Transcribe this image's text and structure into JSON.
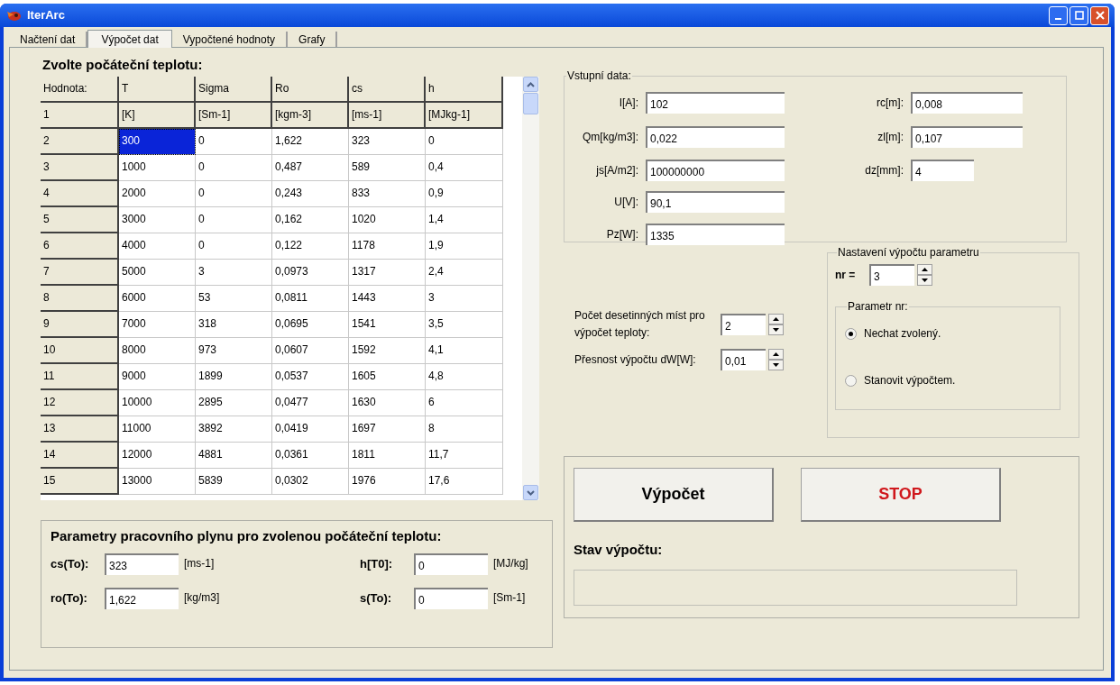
{
  "window": {
    "title": "IterArc"
  },
  "tabs": [
    {
      "label": "Načtení dat",
      "selected": false
    },
    {
      "label": "Výpočet dat",
      "selected": true
    },
    {
      "label": "Vypočtené hodnoty",
      "selected": false
    },
    {
      "label": "Grafy",
      "selected": false
    }
  ],
  "grid": {
    "title": "Zvolte počáteční teplotu:",
    "columns": [
      "Hodnota:",
      "T",
      "Sigma",
      "Ro",
      "cs",
      "h"
    ],
    "units": [
      "1",
      "[K]",
      "[Sm-1]",
      "[kgm-3]",
      "[ms-1]",
      "[MJkg-1]"
    ],
    "rows": [
      {
        "cells": [
          {
            "text": "2",
            "selected": false
          },
          {
            "text": "300",
            "selected": true
          },
          {
            "text": "0",
            "selected": false
          },
          {
            "text": "1,622",
            "selected": false
          },
          {
            "text": "323",
            "selected": false
          },
          {
            "text": "0",
            "selected": false
          }
        ]
      },
      {
        "cells": [
          {
            "text": "3",
            "selected": false
          },
          {
            "text": "1000",
            "selected": false
          },
          {
            "text": "0",
            "selected": false
          },
          {
            "text": "0,487",
            "selected": false
          },
          {
            "text": "589",
            "selected": false
          },
          {
            "text": "0,4",
            "selected": false
          }
        ]
      },
      {
        "cells": [
          {
            "text": "4",
            "selected": false
          },
          {
            "text": "2000",
            "selected": false
          },
          {
            "text": "0",
            "selected": false
          },
          {
            "text": "0,243",
            "selected": false
          },
          {
            "text": "833",
            "selected": false
          },
          {
            "text": "0,9",
            "selected": false
          }
        ]
      },
      {
        "cells": [
          {
            "text": "5",
            "selected": false
          },
          {
            "text": "3000",
            "selected": false
          },
          {
            "text": "0",
            "selected": false
          },
          {
            "text": "0,162",
            "selected": false
          },
          {
            "text": "1020",
            "selected": false
          },
          {
            "text": "1,4",
            "selected": false
          }
        ]
      },
      {
        "cells": [
          {
            "text": "6",
            "selected": false
          },
          {
            "text": "4000",
            "selected": false
          },
          {
            "text": "0",
            "selected": false
          },
          {
            "text": "0,122",
            "selected": false
          },
          {
            "text": "1178",
            "selected": false
          },
          {
            "text": "1,9",
            "selected": false
          }
        ]
      },
      {
        "cells": [
          {
            "text": "7",
            "selected": false
          },
          {
            "text": "5000",
            "selected": false
          },
          {
            "text": "3",
            "selected": false
          },
          {
            "text": "0,0973",
            "selected": false
          },
          {
            "text": "1317",
            "selected": false
          },
          {
            "text": "2,4",
            "selected": false
          }
        ]
      },
      {
        "cells": [
          {
            "text": "8",
            "selected": false
          },
          {
            "text": "6000",
            "selected": false
          },
          {
            "text": "53",
            "selected": false
          },
          {
            "text": "0,0811",
            "selected": false
          },
          {
            "text": "1443",
            "selected": false
          },
          {
            "text": "3",
            "selected": false
          }
        ]
      },
      {
        "cells": [
          {
            "text": "9",
            "selected": false
          },
          {
            "text": "7000",
            "selected": false
          },
          {
            "text": "318",
            "selected": false
          },
          {
            "text": "0,0695",
            "selected": false
          },
          {
            "text": "1541",
            "selected": false
          },
          {
            "text": "3,5",
            "selected": false
          }
        ]
      },
      {
        "cells": [
          {
            "text": "10",
            "selected": false
          },
          {
            "text": "8000",
            "selected": false
          },
          {
            "text": "973",
            "selected": false
          },
          {
            "text": "0,0607",
            "selected": false
          },
          {
            "text": "1592",
            "selected": false
          },
          {
            "text": "4,1",
            "selected": false
          }
        ]
      },
      {
        "cells": [
          {
            "text": "11",
            "selected": false
          },
          {
            "text": "9000",
            "selected": false
          },
          {
            "text": "1899",
            "selected": false
          },
          {
            "text": "0,0537",
            "selected": false
          },
          {
            "text": "1605",
            "selected": false
          },
          {
            "text": "4,8",
            "selected": false
          }
        ]
      },
      {
        "cells": [
          {
            "text": "12",
            "selected": false
          },
          {
            "text": "10000",
            "selected": false
          },
          {
            "text": "2895",
            "selected": false
          },
          {
            "text": "0,0477",
            "selected": false
          },
          {
            "text": "1630",
            "selected": false
          },
          {
            "text": "6",
            "selected": false
          }
        ]
      },
      {
        "cells": [
          {
            "text": "13",
            "selected": false
          },
          {
            "text": "11000",
            "selected": false
          },
          {
            "text": "3892",
            "selected": false
          },
          {
            "text": "0,0419",
            "selected": false
          },
          {
            "text": "1697",
            "selected": false
          },
          {
            "text": "8",
            "selected": false
          }
        ]
      },
      {
        "cells": [
          {
            "text": "14",
            "selected": false
          },
          {
            "text": "12000",
            "selected": false
          },
          {
            "text": "4881",
            "selected": false
          },
          {
            "text": "0,0361",
            "selected": false
          },
          {
            "text": "1811",
            "selected": false
          },
          {
            "text": "11,7",
            "selected": false
          }
        ]
      },
      {
        "cells": [
          {
            "text": "15",
            "selected": false
          },
          {
            "text": "13000",
            "selected": false
          },
          {
            "text": "5839",
            "selected": false
          },
          {
            "text": "0,0302",
            "selected": false
          },
          {
            "text": "1976",
            "selected": false
          },
          {
            "text": "17,6",
            "selected": false
          }
        ]
      }
    ]
  },
  "gas_params": {
    "title": "Parametry pracovního plynu pro zvolenou počáteční teplotu:",
    "fields": [
      {
        "label": "cs(To):",
        "value": "323",
        "unit": "[ms-1]"
      },
      {
        "label": "h[T0]:",
        "value": "0",
        "unit": "[MJ/kg]"
      },
      {
        "label": "ro(To):",
        "value": "1,622",
        "unit": "[kg/m3]"
      },
      {
        "label": "s(To):",
        "value": "0",
        "unit": "[Sm-1]"
      }
    ]
  },
  "input_data": {
    "title": "Vstupní data:",
    "left": [
      {
        "label": "I[A]:",
        "value": "102"
      },
      {
        "label": "Qm[kg/m3]:",
        "value": "0,022"
      },
      {
        "label": "js[A/m2]:",
        "value": "100000000"
      },
      {
        "label": "U[V]:",
        "value": "90,1"
      },
      {
        "label": "Pz[W]:",
        "value": "1335"
      }
    ],
    "right": [
      {
        "label": "rc[m]:",
        "value": "0,008"
      },
      {
        "label": "zl[m]:",
        "value": "0,107"
      },
      {
        "label": "dz[mm]:",
        "value": "4"
      }
    ]
  },
  "spinners": [
    {
      "label": "Počet desetinných míst pro výpočet teploty:",
      "value": "2"
    },
    {
      "label": "Přesnost výpočtu dW[W]:",
      "value": "0,01"
    }
  ],
  "param_settings": {
    "title": "Nastavení výpočtu parametru",
    "nr_label": "nr =",
    "nr_value": "3",
    "group_title": "Parametr nr:",
    "options": [
      {
        "label": "Nechat zvolený.",
        "selected": true
      },
      {
        "label": "Stanovit výpočtem.",
        "selected": false
      }
    ]
  },
  "buttons": [
    {
      "label": "Výpočet",
      "kind": "run"
    },
    {
      "label": "STOP",
      "kind": "stop"
    }
  ],
  "status": {
    "label": "Stav výpočtu:"
  }
}
